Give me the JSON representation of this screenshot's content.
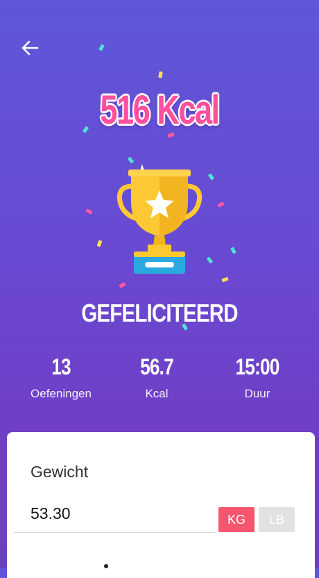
{
  "header": {
    "back_icon": "arrow-left-icon"
  },
  "result": {
    "calories_title": "516 Kcal",
    "trophy_icon": "trophy-icon",
    "congrats": "GEFELICITEERD"
  },
  "stats": [
    {
      "value": "13",
      "label": "Oefeningen"
    },
    {
      "value": "56.7",
      "label": "Kcal"
    },
    {
      "value": "15:00",
      "label": "Duur"
    }
  ],
  "weight_card": {
    "title": "Gewicht",
    "value": "53.30",
    "units": {
      "kg": "KG",
      "lb": "LB"
    },
    "selected_unit": "KG"
  },
  "colors": {
    "background_top": "#5e57d9",
    "background_bottom": "#6b3fc2",
    "title_pink": "#ff4f9e",
    "kg_active": "#f5566e",
    "lb_inactive": "#e2e2e2",
    "trophy_gold": "#fcc935",
    "trophy_base": "#2aa9e0"
  }
}
